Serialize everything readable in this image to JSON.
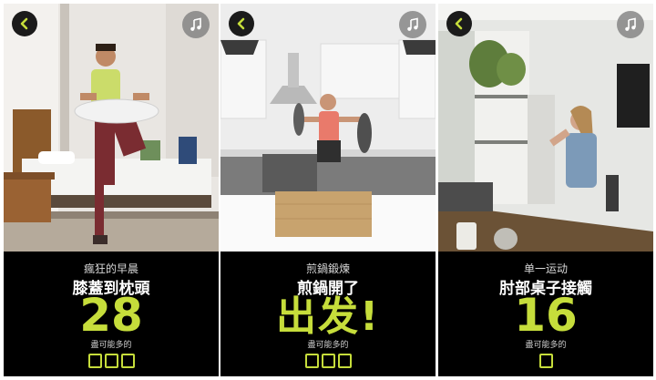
{
  "accent_color": "#c6dd3b",
  "panels": [
    {
      "category": "瘋狂的早晨",
      "exercise": "膝蓋到枕頭",
      "count": "28",
      "hint": "盡可能多的",
      "progress_boxes": 3,
      "back_icon": "chevron-left-icon",
      "music_icon": "music-note-icon"
    },
    {
      "category": "煎鍋鍛煉",
      "exercise": "煎鍋開了",
      "count": "出发!",
      "hint": "盡可能多的",
      "progress_boxes": 3,
      "back_icon": "chevron-left-icon",
      "music_icon": "music-note-icon"
    },
    {
      "category": "单一运动",
      "exercise": "肘部桌子接觸",
      "count": "16",
      "hint": "盡可能多的",
      "progress_boxes": 1,
      "back_icon": "chevron-left-icon",
      "music_icon": "music-note-icon"
    }
  ]
}
